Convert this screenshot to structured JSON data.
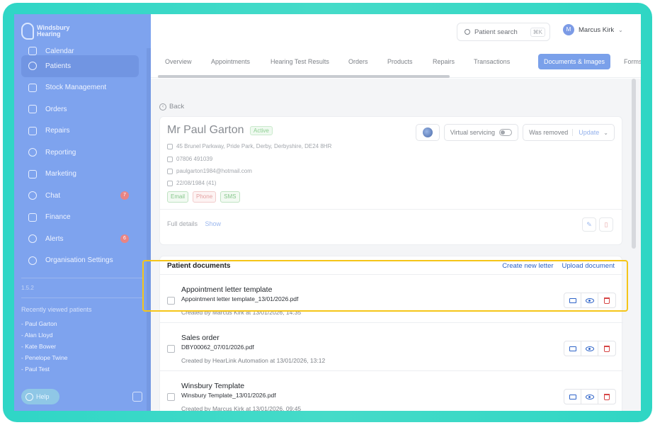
{
  "brand": {
    "name": "Windsbury Hearing"
  },
  "sidebar": {
    "items": [
      {
        "label": "Calendar",
        "icon": "calendar-icon"
      },
      {
        "label": "Patients",
        "icon": "patients-icon",
        "active": true
      },
      {
        "label": "Stock Management",
        "icon": "stock-icon"
      },
      {
        "label": "Orders",
        "icon": "orders-icon"
      },
      {
        "label": "Repairs",
        "icon": "wrench-icon"
      },
      {
        "label": "Reporting",
        "icon": "chart-pie-icon"
      },
      {
        "label": "Marketing",
        "icon": "mail-icon"
      },
      {
        "label": "Chat",
        "icon": "chat-icon",
        "badge": "7"
      },
      {
        "label": "Finance",
        "icon": "card-icon"
      },
      {
        "label": "Alerts",
        "icon": "bell-icon",
        "badge": "6"
      },
      {
        "label": "Organisation Settings",
        "icon": "gear-icon"
      }
    ],
    "version": "1.5.2",
    "recent_title": "Recently viewed patients",
    "recent": [
      "- Paul Garton",
      "- Alan Lloyd",
      "- Kate Bower",
      "- Penelope Twine",
      "- Paul Test"
    ],
    "help_label": "Help"
  },
  "topbar": {
    "search_label": "Patient search",
    "search_shortcut": "⌘K",
    "user_initial": "M",
    "user_name": "Marcus Kirk"
  },
  "tabs": [
    "Overview",
    "Appointments",
    "Hearing Test Results",
    "Orders",
    "Products",
    "Repairs",
    "Transactions",
    "Documents & Images",
    "Forms"
  ],
  "active_tab": "Documents & Images",
  "back_label": "Back",
  "patient": {
    "name": "Mr Paul Garton",
    "status": "Active",
    "address": "45 Brunel Parkway, Pride Park, Derby, Derbyshire, DE24 8HR",
    "phone": "07806 491039",
    "email": "paulgarton1984@hotmail.com",
    "dob": "22/08/1984 (41)",
    "chips": [
      "Email",
      "Phone",
      "SMS"
    ],
    "virtual_servicing_label": "Virtual servicing",
    "was_removed_label": "Was removed",
    "update_label": "Update",
    "full_details_label": "Full details",
    "show_label": "Show"
  },
  "documents": {
    "header": "Patient documents",
    "create_label": "Create new letter",
    "upload_label": "Upload document",
    "items": [
      {
        "title": "Appointment letter template",
        "file": "Appointment letter template_13/01/2026.pdf",
        "meta": "Created by Marcus Kirk at 13/01/2026, 14:35"
      },
      {
        "title": "Sales order",
        "file": "DBY00062_07/01/2026.pdf",
        "meta": "Created by HearLink Automation at 13/01/2026, 13:12"
      },
      {
        "title": "Winsbury Template",
        "file": "Winsbury Template_13/01/2026.pdf",
        "meta": "Created by Marcus Kirk at 13/01/2026, 09:45"
      }
    ]
  },
  "colors": {
    "frame": "#2fd6c6",
    "sidebar": "#7ea3ee",
    "accent": "#2d63c8",
    "highlight": "#f5c518",
    "danger": "#d64545"
  }
}
